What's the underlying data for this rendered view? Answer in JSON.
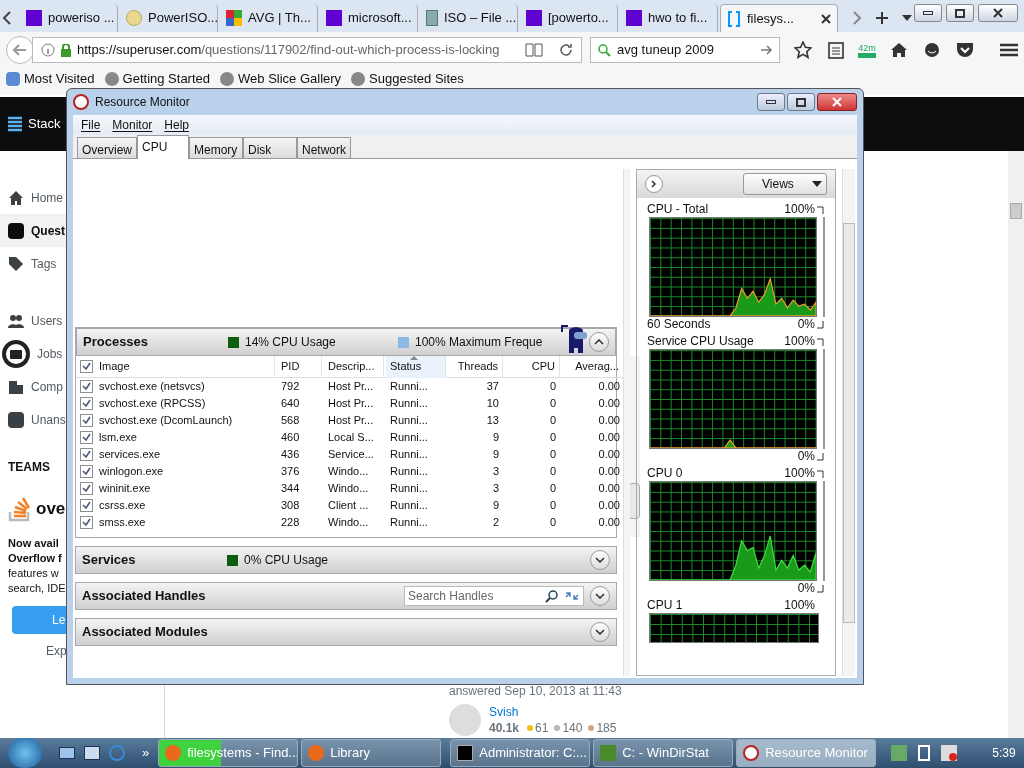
{
  "browser": {
    "tabs": [
      {
        "label": "poweriso ...",
        "selected": false,
        "kind": "yahoo"
      },
      {
        "label": "PowerISO...",
        "selected": false,
        "kind": "disc"
      },
      {
        "label": "AVG | Th...",
        "selected": false,
        "kind": "squares"
      },
      {
        "label": "microsoft...",
        "selected": false,
        "kind": "yahoo"
      },
      {
        "label": "ISO – File ...",
        "selected": false,
        "kind": "book"
      },
      {
        "label": "[powerto...",
        "selected": false,
        "kind": "yahoo"
      },
      {
        "label": "hwo to fi...",
        "selected": false,
        "kind": "yahoo"
      },
      {
        "label": "filesys...",
        "selected": true,
        "kind": "bracket"
      }
    ],
    "url_host": "https://superuser.com",
    "url_path": "/questions/117902/find-out-which-process-is-locking",
    "search": "avg tuneup 2009",
    "badge": "42m",
    "bookmarks": [
      "Most Visited",
      "Getting Started",
      "Web Slice Gallery",
      "Suggested Sites"
    ]
  },
  "page": {
    "logo": "Stack",
    "nav": [
      {
        "label": "Home",
        "selected": false,
        "kind": "home"
      },
      {
        "label": "Quest",
        "selected": true,
        "kind": "question"
      },
      {
        "label": "Tags",
        "selected": false,
        "kind": "tag"
      },
      {
        "label": "Users",
        "selected": false,
        "kind": "users"
      },
      {
        "label": "Jobs",
        "selected": false,
        "kind": "jobs"
      },
      {
        "label": "Comp",
        "selected": false,
        "kind": "building"
      },
      {
        "label": "Unans",
        "selected": false,
        "kind": "answer"
      }
    ],
    "teams_heading": "TEAMS",
    "teams_logo": "ove",
    "promo_title": [
      "Now avail",
      "Overflow f"
    ],
    "promo_body": [
      "features w",
      "search, IDE"
    ],
    "promo_button": "Le",
    "promo_link": "Exp",
    "answered": "answered Sep 10, 2013 at 11:43",
    "user": "Svish",
    "reputation": "40.1k",
    "badges": [
      {
        "count": "61",
        "color": "#f0c20c"
      },
      {
        "count": "140",
        "color": "#b4b8bc"
      },
      {
        "count": "185",
        "color": "#d1a684"
      }
    ]
  },
  "monitor": {
    "title": "Resource Monitor",
    "menus": [
      "File",
      "Monitor",
      "Help"
    ],
    "tabs": [
      {
        "label": "Overview",
        "selected": false
      },
      {
        "label": "CPU",
        "selected": true
      },
      {
        "label": "Memory",
        "selected": false
      },
      {
        "label": "Disk",
        "selected": false
      },
      {
        "label": "Network",
        "selected": false
      }
    ],
    "sections": [
      {
        "title": "Processes",
        "expanded": true,
        "legends": [
          {
            "text": "14% CPU Usage",
            "color": "#0b5e0b"
          },
          {
            "text": "100% Maximum Freque",
            "color": "#8cb8e4"
          }
        ],
        "columns": [
          {
            "label": "Image",
            "sorted": false
          },
          {
            "label": "PID",
            "sorted": false
          },
          {
            "label": "Descrip...",
            "sorted": false
          },
          {
            "label": "Status",
            "sorted": true
          },
          {
            "label": "Threads",
            "sorted": false
          },
          {
            "label": "CPU",
            "sorted": false
          },
          {
            "label": "Averag...",
            "sorted": false
          }
        ],
        "header_checked": true,
        "rows": [
          {
            "checked": true,
            "cells": [
              "svchost.exe (netsvcs)",
              "792",
              "Host Pr...",
              "Runni...",
              "37",
              "0",
              "0.00"
            ]
          },
          {
            "checked": true,
            "cells": [
              "svchost.exe (RPCSS)",
              "640",
              "Host Pr...",
              "Runni...",
              "10",
              "0",
              "0.00"
            ]
          },
          {
            "checked": true,
            "cells": [
              "svchost.exe (DcomLaunch)",
              "568",
              "Host Pr...",
              "Runni...",
              "13",
              "0",
              "0.00"
            ]
          },
          {
            "checked": true,
            "cells": [
              "lsm.exe",
              "460",
              "Local S...",
              "Runni...",
              "9",
              "0",
              "0.00"
            ]
          },
          {
            "checked": true,
            "cells": [
              "services.exe",
              "436",
              "Service...",
              "Runni...",
              "9",
              "0",
              "0.00"
            ]
          },
          {
            "checked": true,
            "cells": [
              "winlogon.exe",
              "376",
              "Windo...",
              "Runni...",
              "3",
              "0",
              "0.00"
            ]
          },
          {
            "checked": true,
            "cells": [
              "wininit.exe",
              "344",
              "Windo...",
              "Runni...",
              "3",
              "0",
              "0.00"
            ]
          },
          {
            "checked": true,
            "cells": [
              "csrss.exe",
              "308",
              "Client ...",
              "Runni...",
              "9",
              "0",
              "0.00"
            ]
          },
          {
            "checked": true,
            "cells": [
              "smss.exe",
              "228",
              "Windo...",
              "Runni...",
              "2",
              "0",
              "0.00"
            ]
          }
        ]
      },
      {
        "title": "Services",
        "expanded": false,
        "legends": [
          {
            "text": "0% CPU Usage",
            "color": "#0b5e0b"
          }
        ]
      },
      {
        "title": "Associated Handles",
        "expanded": false,
        "search_placeholder": "Search Handles"
      },
      {
        "title": "Associated Modules",
        "expanded": false
      }
    ],
    "views": "Views",
    "charts": [
      {
        "title": "CPU - Total",
        "top_label": "100%",
        "bottom_label": "0%",
        "xlabel": "60 Seconds"
      },
      {
        "title": "Service CPU Usage",
        "top_label": "100%",
        "bottom_label": "0%"
      },
      {
        "title": "CPU 0",
        "top_label": "100%",
        "bottom_label": "0%"
      },
      {
        "title": "CPU 1",
        "top_label": "100%"
      }
    ]
  },
  "taskbar": {
    "tasks": [
      {
        "label": "filesystems - Find...",
        "selected": false,
        "level": 0.45,
        "kind": "firefox"
      },
      {
        "label": "Library",
        "selected": false,
        "kind": "firefox"
      },
      {
        "label": "Administrator: C:...",
        "selected": false,
        "kind": "console"
      },
      {
        "label": "C: - WinDirStat",
        "selected": false,
        "kind": "tree"
      },
      {
        "label": "Resource Monitor",
        "selected": true,
        "kind": "monitor"
      }
    ],
    "more": "»",
    "clock": "5:39"
  }
}
